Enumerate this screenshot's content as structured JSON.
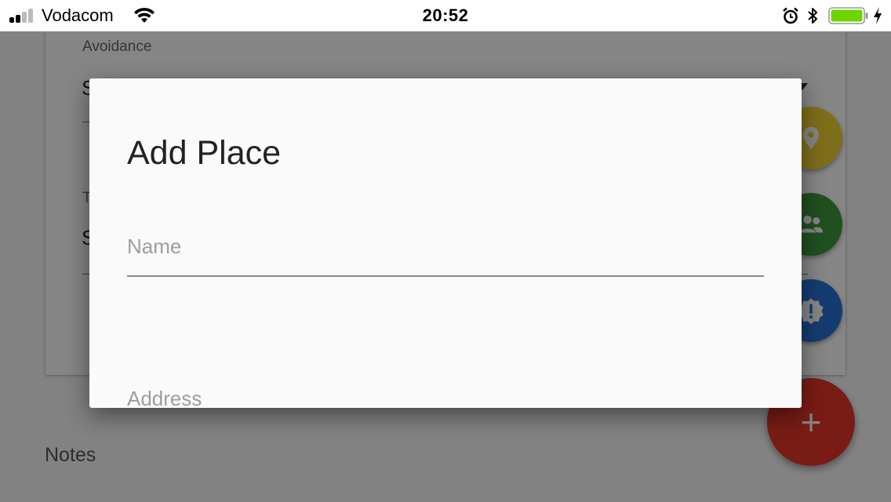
{
  "status_bar": {
    "carrier": "Vodacom",
    "time": "20:52",
    "battery_color": "#6dd400",
    "signal_bars_filled": 2,
    "signal_bars_total": 4,
    "icons": [
      "signal-icon",
      "wifi-icon",
      "alarm-icon",
      "bluetooth-icon",
      "battery-icon",
      "charging-icon"
    ]
  },
  "background": {
    "avoidance_label": "Avoidance",
    "avoidance_value": "S",
    "second_field_label": "T",
    "second_field_value": "S",
    "notes_label": "Notes",
    "fabs": {
      "place_color": "#f2d335",
      "people_color": "#3f9a3f",
      "alert_color": "#2a74d6",
      "add_color": "#e8362b",
      "add_label": "+"
    }
  },
  "dialog": {
    "title": "Add Place",
    "name_field": {
      "placeholder": "Name",
      "value": ""
    },
    "address_field": {
      "placeholder": "Address",
      "value": ""
    }
  }
}
